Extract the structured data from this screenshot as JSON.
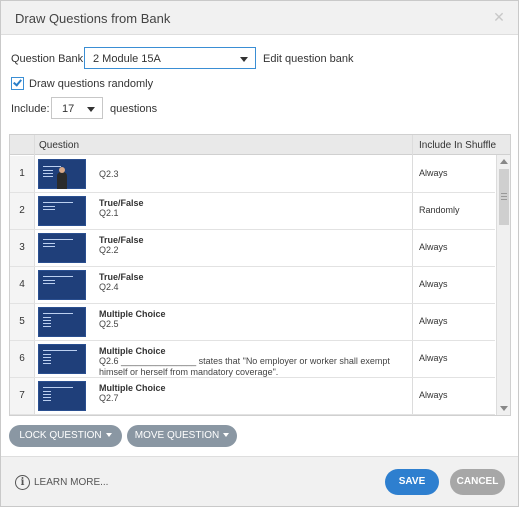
{
  "dialog": {
    "title": "Draw Questions from Bank",
    "close_icon": "close-icon"
  },
  "bank": {
    "label": "Question Bank:",
    "selected": "2 Module 15A",
    "edit_link": "Edit question bank"
  },
  "draw_random": {
    "label": "Draw questions randomly",
    "checked": true
  },
  "include": {
    "label": "Include:",
    "value": "17",
    "suffix": "questions"
  },
  "table": {
    "headers": {
      "question": "Question",
      "shuffle": "Include In Shuffle"
    },
    "rows": [
      {
        "num": "1",
        "type": "",
        "text": "Q2.3",
        "shuffle": "Always"
      },
      {
        "num": "2",
        "type": "True/False",
        "text": "Q2.1",
        "shuffle": "Randomly"
      },
      {
        "num": "3",
        "type": "True/False",
        "text": "Q2.2",
        "shuffle": "Always"
      },
      {
        "num": "4",
        "type": "True/False",
        "text": "Q2.4",
        "shuffle": "Always"
      },
      {
        "num": "5",
        "type": "Multiple Choice",
        "text": "Q2.5",
        "shuffle": "Always"
      },
      {
        "num": "6",
        "type": "Multiple Choice",
        "text": "Q2.6 _______________ states that \"No employer or worker shall exempt himself or herself from mandatory coverage\".",
        "shuffle": "Always"
      },
      {
        "num": "7",
        "type": "Multiple Choice",
        "text": "Q2.7",
        "shuffle": "Always"
      }
    ]
  },
  "actions": {
    "lock": "LOCK QUESTION",
    "move": "MOVE QUESTION"
  },
  "footer": {
    "learn_more": "LEARN MORE...",
    "save": "SAVE",
    "cancel": "CANCEL"
  },
  "colors": {
    "accent": "#2e7fcf",
    "thumb": "#1f3f7a",
    "pill": "#8a97a3"
  }
}
